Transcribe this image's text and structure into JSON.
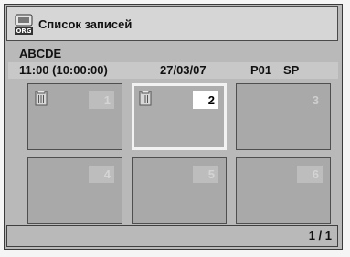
{
  "header": {
    "icon_name": "org-icon",
    "icon_label": "ORG",
    "title": "Список записей"
  },
  "record": {
    "title": "ABCDE",
    "time": "11:00 (10:00:00)",
    "date": "27/03/07",
    "program": "P01",
    "mode": "SP"
  },
  "thumbnails": [
    {
      "number": "1",
      "protected": true,
      "selected": false
    },
    {
      "number": "2",
      "protected": true,
      "selected": true
    },
    {
      "number": "3",
      "protected": false,
      "selected": false
    },
    {
      "number": "4",
      "protected": false,
      "selected": false
    },
    {
      "number": "5",
      "protected": false,
      "selected": false
    },
    {
      "number": "6",
      "protected": false,
      "selected": false
    }
  ],
  "footer": {
    "page": "1 / 1"
  },
  "colors": {
    "panel": "#b9b9b9",
    "header": "#d6d6d6",
    "highlight": "#ffffff"
  }
}
